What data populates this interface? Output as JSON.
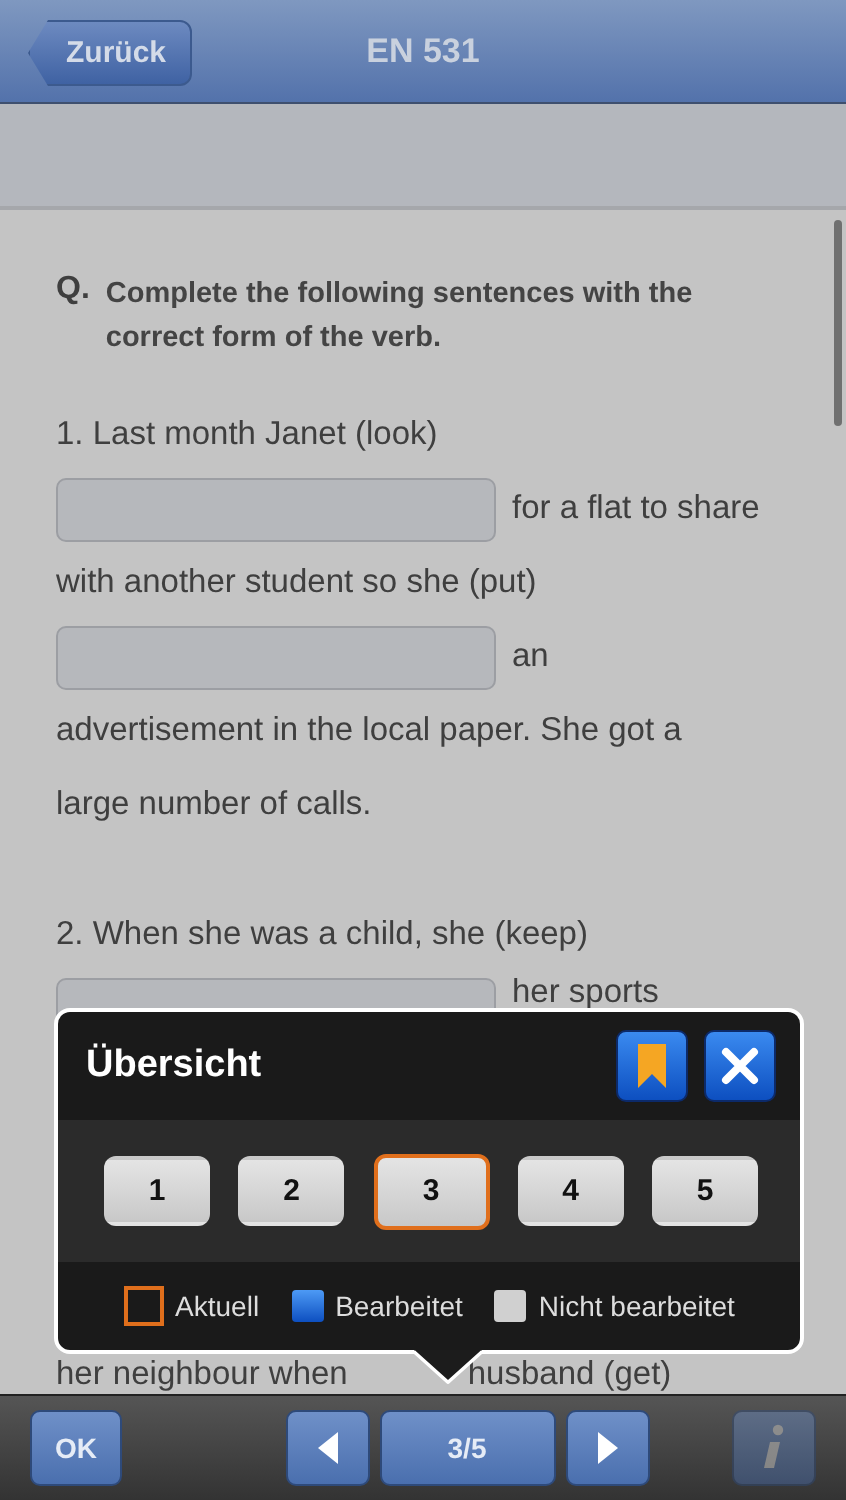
{
  "nav_bar": {
    "back_button": "Zurück",
    "title": "EN 531"
  },
  "question": {
    "marker": "Q.",
    "instruction": "Complete the following sentences with the correct form of the verb."
  },
  "exercises": [
    {
      "lines": [
        {
          "kind": "text",
          "text": "1. Last month Janet (look)"
        },
        {
          "kind": "blank",
          "text": "for a flat to share"
        },
        {
          "kind": "text",
          "text": "with another student so she (put)"
        },
        {
          "kind": "blank",
          "text": "an"
        },
        {
          "kind": "text",
          "text": "advertisement in the local paper. She got a"
        },
        {
          "kind": "text",
          "text": "large number of calls."
        }
      ]
    },
    {
      "lines": [
        {
          "kind": "text",
          "text": "2. When she was a child, she (keep)"
        },
        {
          "kind": "blank",
          "text": "her sports"
        },
        {
          "kind": "gap"
        },
        {
          "kind": "split",
          "parts": [
            "her neighbour when",
            "husband (get)"
          ]
        }
      ]
    }
  ],
  "overview": {
    "title": "Übersicht",
    "pages": [
      {
        "label": "1",
        "selected": false
      },
      {
        "label": "2",
        "selected": false
      },
      {
        "label": "3",
        "selected": true
      },
      {
        "label": "4",
        "selected": false
      },
      {
        "label": "5",
        "selected": false
      }
    ],
    "legend": [
      {
        "kind": "current",
        "label": "Aktuell"
      },
      {
        "kind": "edited",
        "label": "Bearbeitet"
      },
      {
        "kind": "unedited",
        "label": "Nicht bearbeitet"
      }
    ]
  },
  "toolbar": {
    "ok_button": "OK",
    "page_indicator": "3/5",
    "info_disabled": true
  }
}
